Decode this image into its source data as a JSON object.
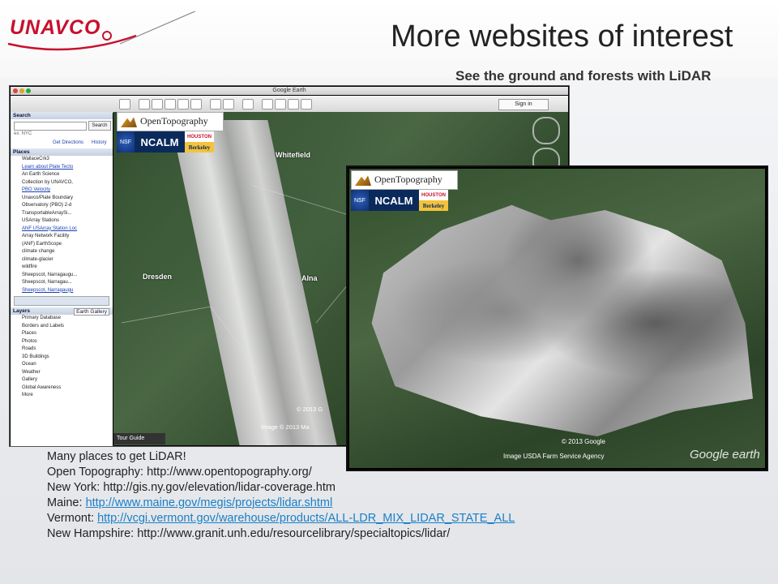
{
  "logo": {
    "text": "UNAVCO"
  },
  "slide": {
    "title": "More websites of interest",
    "subtitle": "See the ground and forests with LiDAR"
  },
  "google_earth": {
    "window_title": "Google Earth",
    "sign_in": "Sign in",
    "sidebar": {
      "search_header": "Search",
      "search_button": "Search",
      "search_hint": "ex: NYC",
      "get_directions": "Get Directions",
      "history": "History",
      "places_header": "Places",
      "places_items": [
        "WallaceCrk3",
        "Learn about Plate Tecto",
        "An Earth Science",
        "Collection by UNAVCO,",
        "PBO Velocity",
        "Unavco/Plate Boundary",
        "Observatory (PBO) 2-d",
        "TransportableArraySi...",
        "USArray Stations",
        "ANF USArray Station Loc",
        "Array Network Facility",
        "(ANF) EarthScope",
        "climate change",
        "climate-glacier",
        "wildfire",
        "Sheepscot, Narragaugu...",
        "Sheepscot, Narragau...",
        "Sheepscot, Narragaugu"
      ],
      "layers_header": "Layers",
      "earth_gallery": "Earth Gallery",
      "layers_items": [
        "Primary Database",
        "Borders and Labels",
        "Places",
        "Photos",
        "Roads",
        "3D Buildings",
        "Ocean",
        "Weather",
        "Gallery",
        "Global Awareness",
        "More"
      ]
    },
    "map": {
      "labels": [
        "Whitefield",
        "Dresden",
        "Alna"
      ],
      "copyright_1": "© 2013 G",
      "copyright_2": "Image © 2013 Ma",
      "tour_guide": "Tour Guide"
    }
  },
  "branding": {
    "open_topography": "OpenTopography",
    "nsf": "NSF",
    "ncalm": "NCALM",
    "houston": "HOUSTON",
    "berkeley": "Berkeley"
  },
  "second_view": {
    "copyright": "© 2013 Google",
    "image_credit": "Image USDA Farm Service Agency",
    "watermark": "Google earth"
  },
  "notes": {
    "line1": "Many places to get LiDAR!",
    "line2": "Open Topography: http://www.opentopography.org/",
    "line3": "New York: http://gis.ny.gov/elevation/lidar-coverage.htm",
    "line4_label": "Maine: ",
    "line4_link": "http://www.maine.gov/megis/projects/lidar.shtml",
    "line5_label": "Vermont: ",
    "line5_link": "http://vcgi.vermont.gov/warehouse/products/ALL-LDR_MIX_LIDAR_STATE_ALL",
    "line6": "New Hampshire: http://www.granit.unh.edu/resourcelibrary/specialtopics/lidar/"
  },
  "colors": {
    "brand_red": "#c8102e",
    "link_blue": "#1a7fc7"
  }
}
